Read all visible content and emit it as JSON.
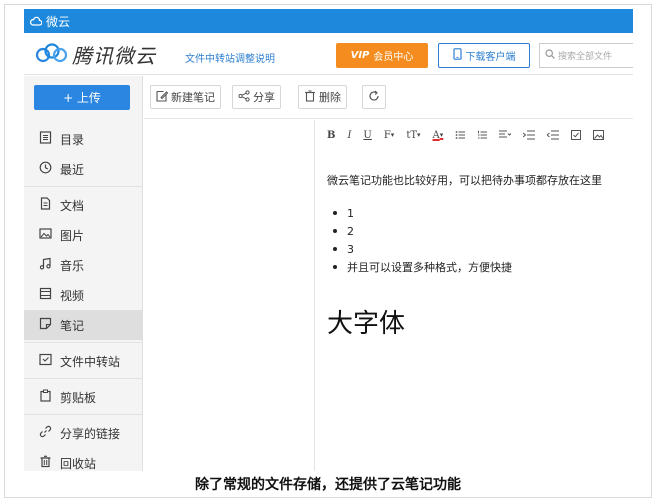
{
  "colors": {
    "titlebar": "#1e89dc",
    "accent": "#2a86e0",
    "vip": "#f58c1f",
    "link": "#2d7fd1",
    "sidebar_bg": "#f4f4f4",
    "active_item_bg": "#dedede"
  },
  "window": {
    "title": "微云",
    "title_icon": "cloud-icon"
  },
  "header": {
    "logo_icon": "weiyun-cloud-logo",
    "logo_text": "腾讯微云",
    "notice_link": "文件中转站调整说明",
    "vip_mark": "VIP",
    "vip_label": "会员中心",
    "download_icon": "phone-icon",
    "download_label": "下载客户端",
    "search_icon": "search-icon",
    "search_placeholder": "搜索全部文件"
  },
  "sidebar": {
    "upload_label": "+ 上传",
    "items": [
      {
        "label": "目录",
        "icon": "directory-icon"
      },
      {
        "label": "最近",
        "icon": "clock-icon"
      },
      {
        "label": "文档",
        "icon": "document-icon"
      },
      {
        "label": "图片",
        "icon": "image-icon"
      },
      {
        "label": "音乐",
        "icon": "music-icon"
      },
      {
        "label": "视频",
        "icon": "video-icon"
      },
      {
        "label": "笔记",
        "icon": "note-icon",
        "active": true
      },
      {
        "label": "文件中转站",
        "icon": "transfer-station-icon"
      },
      {
        "label": "剪贴板",
        "icon": "clipboard-icon"
      },
      {
        "label": "分享的链接",
        "icon": "link-icon"
      },
      {
        "label": "回收站",
        "icon": "trash-icon"
      }
    ]
  },
  "toolbar": {
    "new_note_label": "新建笔记",
    "share_label": "分享",
    "delete_label": "删除",
    "refresh_icon": "refresh-icon"
  },
  "format_bar": {
    "bold": "B",
    "italic": "I",
    "underline": "U",
    "font": "F",
    "font_size": "tT",
    "font_color": "A"
  },
  "note": {
    "line1": "微云笔记功能也比较好用，可以把待办事项都存放在这里",
    "list": [
      "1",
      "2",
      "3",
      "并且可以设置多种格式，方便快捷"
    ],
    "big_text": "大字体"
  },
  "caption": "除了常规的文件存储，还提供了云笔记功能"
}
